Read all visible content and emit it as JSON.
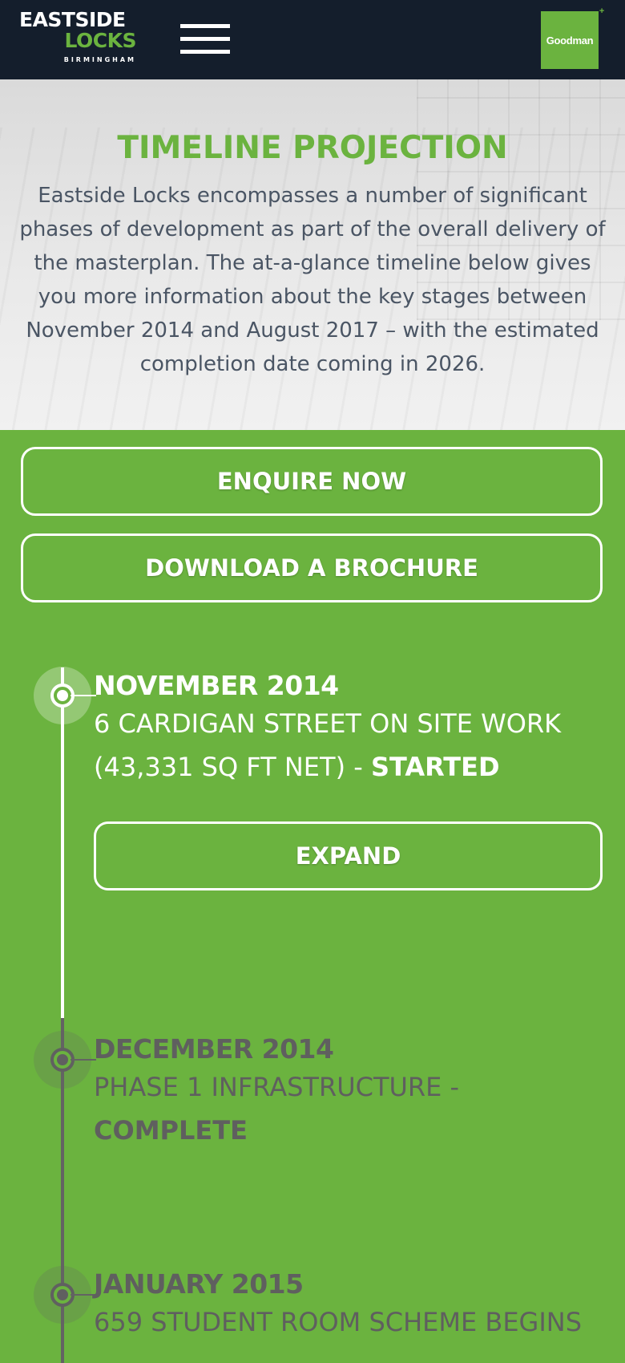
{
  "header": {
    "logo": {
      "line1": "EASTSIDE",
      "line2": "LOCKS",
      "line3": "BIRMINGHAM"
    },
    "menu_icon": "hamburger-menu-icon",
    "partner_logo": {
      "text": "Goodman",
      "mark": "+"
    }
  },
  "intro": {
    "title": "TIMELINE PROJECTION",
    "text": "Eastside Locks encompasses a number of significant phases of development as part of the overall delivery of the masterplan. The at-a-glance timeline below gives you more information about the key stages between November 2014 and August 2017 – with the estimated completion date coming in 2026."
  },
  "actions": {
    "enquire_label": "ENQUIRE NOW",
    "brochure_label": "DOWNLOAD A BROCHURE"
  },
  "timeline": [
    {
      "date": "NOVEMBER 2014",
      "description": "6 CARDIGAN STREET ON SITE WORK (43,331 SQ FT NET) - ",
      "status": "STARTED",
      "expand_label": "EXPAND",
      "active": true
    },
    {
      "date": "DECEMBER 2014",
      "description": "PHASE 1 INFRASTRUCTURE - ",
      "status": "COMPLETE",
      "active": false
    },
    {
      "date": "JANUARY 2015",
      "description": "659 STUDENT ROOM SCHEME BEGINS",
      "status": "",
      "active": false
    }
  ],
  "colors": {
    "brand_green": "#6bb33f",
    "header_navy": "#141e2c",
    "inactive_gray": "#5f5f5f",
    "intro_text": "#4a5564"
  }
}
